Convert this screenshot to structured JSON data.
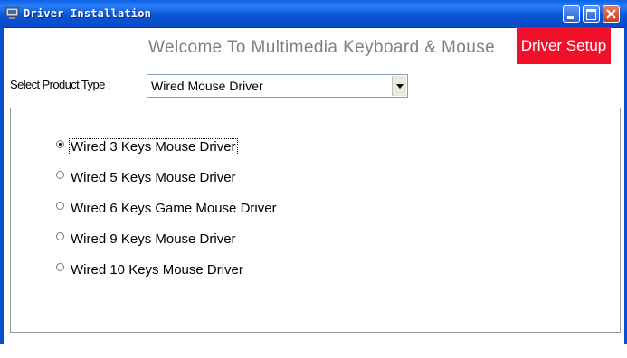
{
  "window": {
    "title": "Driver Installation",
    "controls": [
      "minimize-icon",
      "maximize-icon",
      "close-icon"
    ]
  },
  "header": {
    "welcome_text": "Welcome To Multimedia Keyboard & Mouse",
    "setup_label": "Driver Setup",
    "setup_color": "#f0102a"
  },
  "product_select": {
    "label": "Select Product Type :",
    "selected_value": "Wired Mouse Driver"
  },
  "drivers": [
    {
      "label": "Wired 3 Keys Mouse Driver",
      "selected": true
    },
    {
      "label": "Wired 5 Keys Mouse Driver",
      "selected": false
    },
    {
      "label": "Wired 6 Keys Game Mouse Driver",
      "selected": false
    },
    {
      "label": "Wired 9 Keys Mouse Driver",
      "selected": false
    },
    {
      "label": "Wired 10 Keys Mouse Driver",
      "selected": false
    }
  ],
  "colors": {
    "titlebar": "#0a57d8",
    "accent_red": "#f0102a",
    "welcome_gray": "#808080"
  }
}
